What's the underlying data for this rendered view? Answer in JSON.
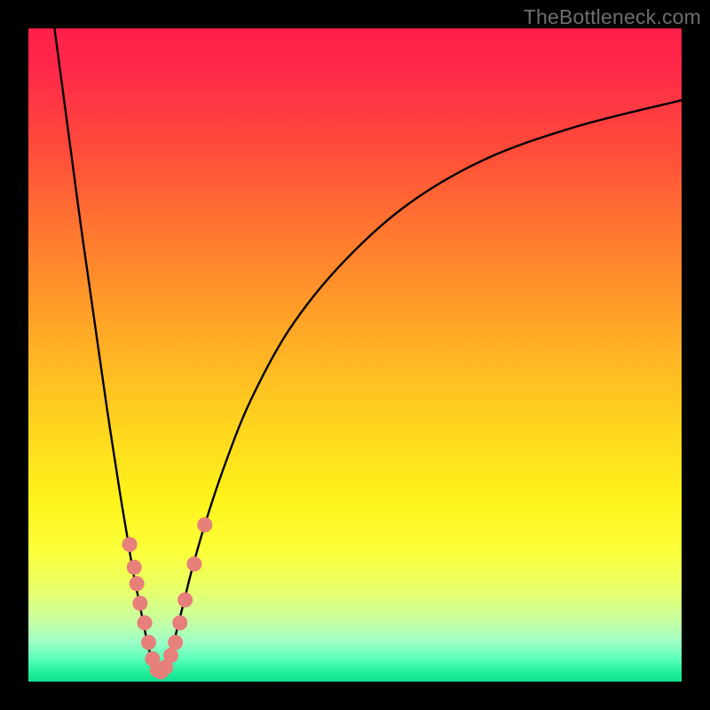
{
  "watermark": {
    "text": "TheBottleneck.com"
  },
  "colors": {
    "frame": "#000000",
    "gradient_stops": [
      {
        "offset": 0.0,
        "color": "#ff1f4b"
      },
      {
        "offset": 0.06,
        "color": "#ff2849"
      },
      {
        "offset": 0.18,
        "color": "#ff4a3b"
      },
      {
        "offset": 0.32,
        "color": "#ff7a2f"
      },
      {
        "offset": 0.46,
        "color": "#ffa726"
      },
      {
        "offset": 0.6,
        "color": "#ffd21f"
      },
      {
        "offset": 0.72,
        "color": "#fff31a"
      },
      {
        "offset": 0.8,
        "color": "#fcff3a"
      },
      {
        "offset": 0.86,
        "color": "#e8ff6a"
      },
      {
        "offset": 0.905,
        "color": "#c9ffa0"
      },
      {
        "offset": 0.94,
        "color": "#9cffc6"
      },
      {
        "offset": 0.965,
        "color": "#5bffb9"
      },
      {
        "offset": 0.985,
        "color": "#22f09c"
      },
      {
        "offset": 1.0,
        "color": "#0fe08f"
      }
    ],
    "curve": "#000000",
    "marker_fill": "#e77f7b",
    "marker_stroke": "#c05a56"
  },
  "chart_data": {
    "type": "line",
    "title": "",
    "xlabel": "",
    "ylabel": "",
    "xlim": [
      0,
      100
    ],
    "ylim": [
      0,
      100
    ],
    "x_optimum": 20,
    "series": [
      {
        "name": "bottleneck-curve",
        "x": [
          4,
          6,
          8,
          10,
          12,
          14,
          15,
          16,
          17,
          18,
          19,
          20,
          21,
          22,
          23,
          24,
          25,
          27,
          30,
          34,
          40,
          48,
          58,
          70,
          84,
          100
        ],
        "y": [
          100,
          85,
          70,
          56,
          42,
          29,
          23,
          17,
          12,
          7,
          3,
          1,
          2,
          5,
          9,
          13,
          17,
          24,
          33,
          43,
          54,
          64,
          73,
          80,
          85,
          89
        ]
      }
    ],
    "markers": {
      "name": "highlight-points",
      "x": [
        15.5,
        16.2,
        16.6,
        17.1,
        17.8,
        18.4,
        19.0,
        19.7,
        20.3,
        21.0,
        21.8,
        22.5,
        23.2,
        24.0,
        25.4,
        27.0
      ],
      "y": [
        21.0,
        17.5,
        15.0,
        12.0,
        9.0,
        6.0,
        3.5,
        1.8,
        1.5,
        2.2,
        4.0,
        6.0,
        9.0,
        12.5,
        18.0,
        24.0
      ]
    }
  }
}
